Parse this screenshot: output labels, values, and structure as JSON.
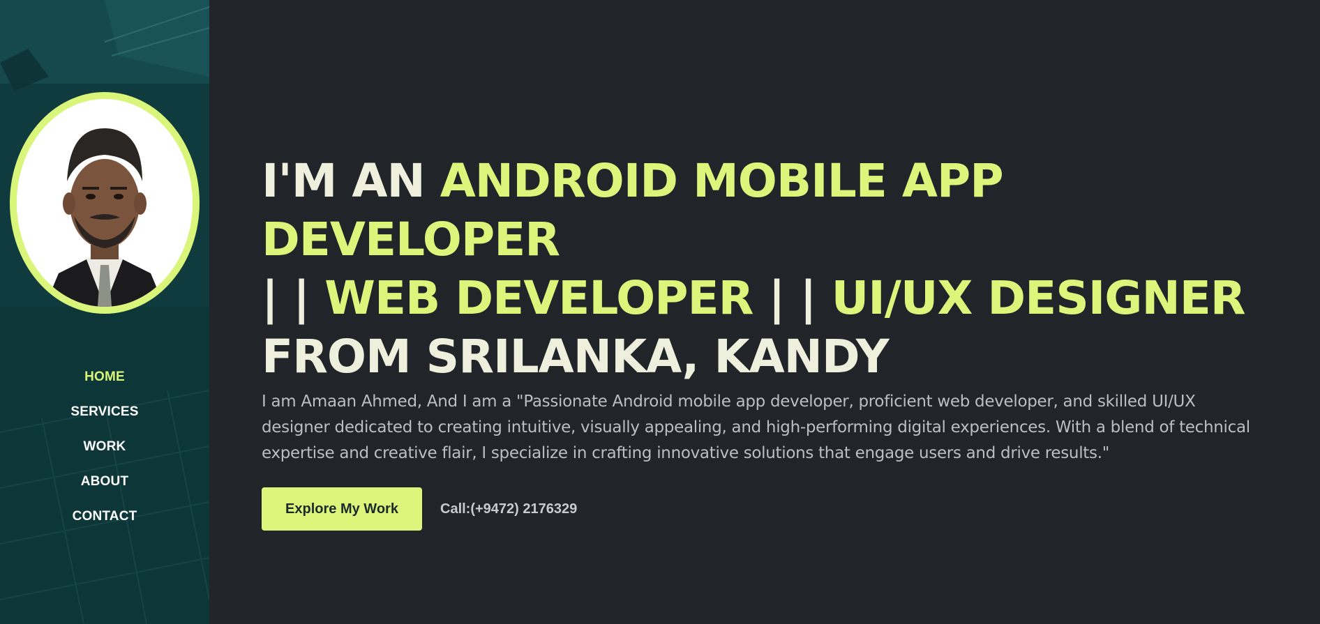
{
  "sidebar": {
    "profile_alt": "Amaan Ahmed",
    "nav": [
      {
        "label": "HOME",
        "active": true
      },
      {
        "label": "SERVICES",
        "active": false
      },
      {
        "label": "WORK",
        "active": false
      },
      {
        "label": "ABOUT",
        "active": false
      },
      {
        "label": "CONTACT",
        "active": false
      }
    ]
  },
  "hero": {
    "headline": {
      "prefix": "I'M AN ",
      "role1": "ANDROID MOBILE APP DEVELOPER",
      "sep1": "| | ",
      "role2": "WEB DEVELOPER",
      "sep2": " | | ",
      "role3": "UI/UX DESIGNER",
      "suffix": "FROM SRILANKA, KANDY"
    },
    "intro": "I am Amaan Ahmed, And I am a \"Passionate Android mobile app developer, proficient web developer, and skilled UI/UX designer dedicated to creating intuitive, visually appealing, and high-performing digital experiences. With a blend of technical expertise and creative flair, I specialize in crafting innovative solutions that engage users and drive results.\"",
    "cta_label": "Explore My Work",
    "phone": "Call:(+9472) 2176329"
  },
  "colors": {
    "background": "#212428",
    "accent": "#dcf57a",
    "sidebar": "#0f3a3d",
    "heading": "#eef0dd",
    "body_text": "#b9bfc4"
  }
}
